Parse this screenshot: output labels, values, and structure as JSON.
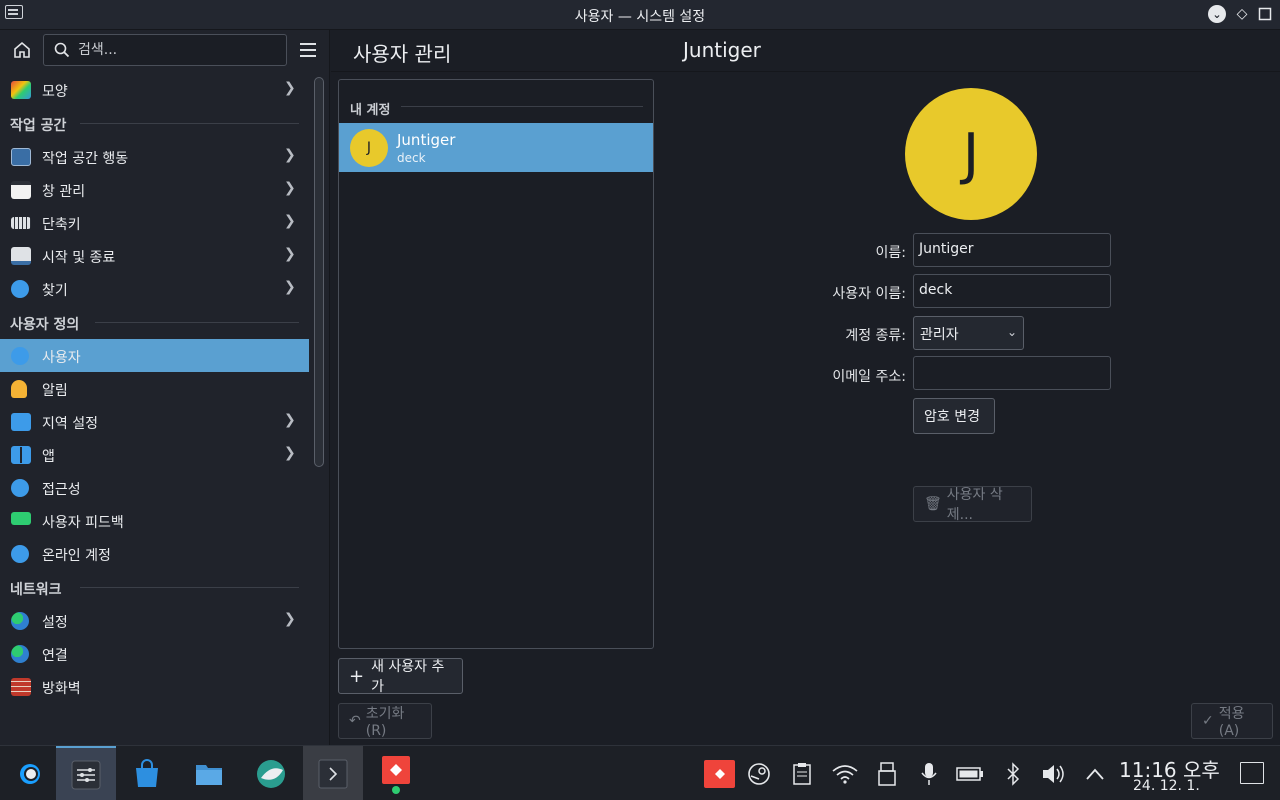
{
  "window": {
    "title": "사용자 — 시스템 설정"
  },
  "sidebar": {
    "search_placeholder": "검색...",
    "top_item": {
      "label": "모양",
      "icon": "appearance-icon"
    },
    "sections": [
      {
        "header": "작업 공간",
        "items": [
          {
            "label": "작업 공간 행동",
            "icon": "workspace-behavior-icon",
            "chevron": true
          },
          {
            "label": "창 관리",
            "icon": "window-management-icon",
            "chevron": true
          },
          {
            "label": "단축키",
            "icon": "keyboard-icon",
            "chevron": true
          },
          {
            "label": "시작 및 종료",
            "icon": "startup-shutdown-icon",
            "chevron": true
          },
          {
            "label": "찾기",
            "icon": "search-icon",
            "chevron": true
          }
        ]
      },
      {
        "header": "사용자 정의",
        "items": [
          {
            "label": "사용자",
            "icon": "users-icon",
            "active": true
          },
          {
            "label": "알림",
            "icon": "bell-icon"
          },
          {
            "label": "지역 설정",
            "icon": "regional-settings-icon",
            "chevron": true
          },
          {
            "label": "앱",
            "icon": "apps-icon",
            "chevron": true
          },
          {
            "label": "접근성",
            "icon": "accessibility-icon"
          },
          {
            "label": "사용자 피드백",
            "icon": "feedback-icon"
          },
          {
            "label": "온라인 계정",
            "icon": "online-accounts-icon"
          }
        ]
      },
      {
        "header": "네트워크",
        "items": [
          {
            "label": "설정",
            "icon": "network-settings-icon",
            "chevron": true
          },
          {
            "label": "연결",
            "icon": "connections-icon"
          },
          {
            "label": "방화벽",
            "icon": "firewall-icon"
          }
        ]
      }
    ]
  },
  "main": {
    "header_title": "사용자 관리",
    "header_user": "Juntiger",
    "accounts": {
      "section_label": "내 계정",
      "list": [
        {
          "initial": "J",
          "name": "Juntiger",
          "username": "deck"
        }
      ]
    },
    "add_user_label": "새 사용자 추가",
    "reset_label": "초기화(R)",
    "apply_label": "적용(A)"
  },
  "user_form": {
    "avatar_initial": "J",
    "name_label": "이름:",
    "name_value": "Juntiger",
    "username_label": "사용자 이름:",
    "username_value": "deck",
    "account_type_label": "계정 종류:",
    "account_type_value": "관리자",
    "email_label": "이메일 주소:",
    "email_value": "",
    "change_password_label": "암호 변경",
    "delete_user_label": "사용자 삭제..."
  },
  "taskbar": {
    "clock_time": "11:16 오후",
    "clock_date": "24. 12. 1."
  },
  "colors": {
    "accent": "#5aa0d1",
    "avatar": "#e8c92b",
    "background": "#1b1e25"
  }
}
